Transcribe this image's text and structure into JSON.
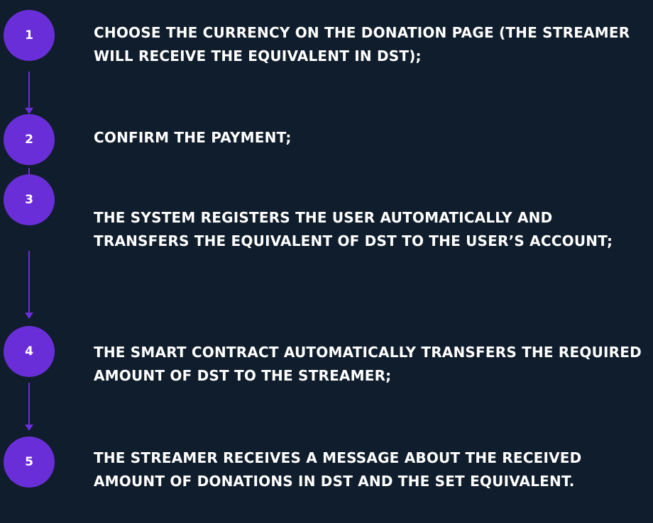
{
  "colors": {
    "background": "#101d2c",
    "accent": "#6a2ed8",
    "text": "#ffffff"
  },
  "steps": [
    {
      "number": "1",
      "text": "CHOOSE THE CURRENCY ON THE DONATION PAGE (THE STREAMER WILL RECEIVE THE EQUIVALENT IN DST);"
    },
    {
      "number": "2",
      "text": "CONFIRM THE PAYMENT;"
    },
    {
      "number": "3",
      "text": "THE SYSTEM REGISTERS THE USER AUTOMATICALLY AND TRANSFERS THE EQUIVALENT OF DST TO THE USER’S ACCOUNT;"
    },
    {
      "number": "4",
      "text": "THE SMART CONTRACT AUTOMATICALLY TRANSFERS THE REQUIRED AMOUNT OF DST TO THE STREAMER;"
    },
    {
      "number": "5",
      "text": "THE STREAMER RECEIVES A MESSAGE ABOUT THE RECEIVED AMOUNT OF DONATIONS IN DST AND THE SET EQUIVALENT."
    }
  ]
}
